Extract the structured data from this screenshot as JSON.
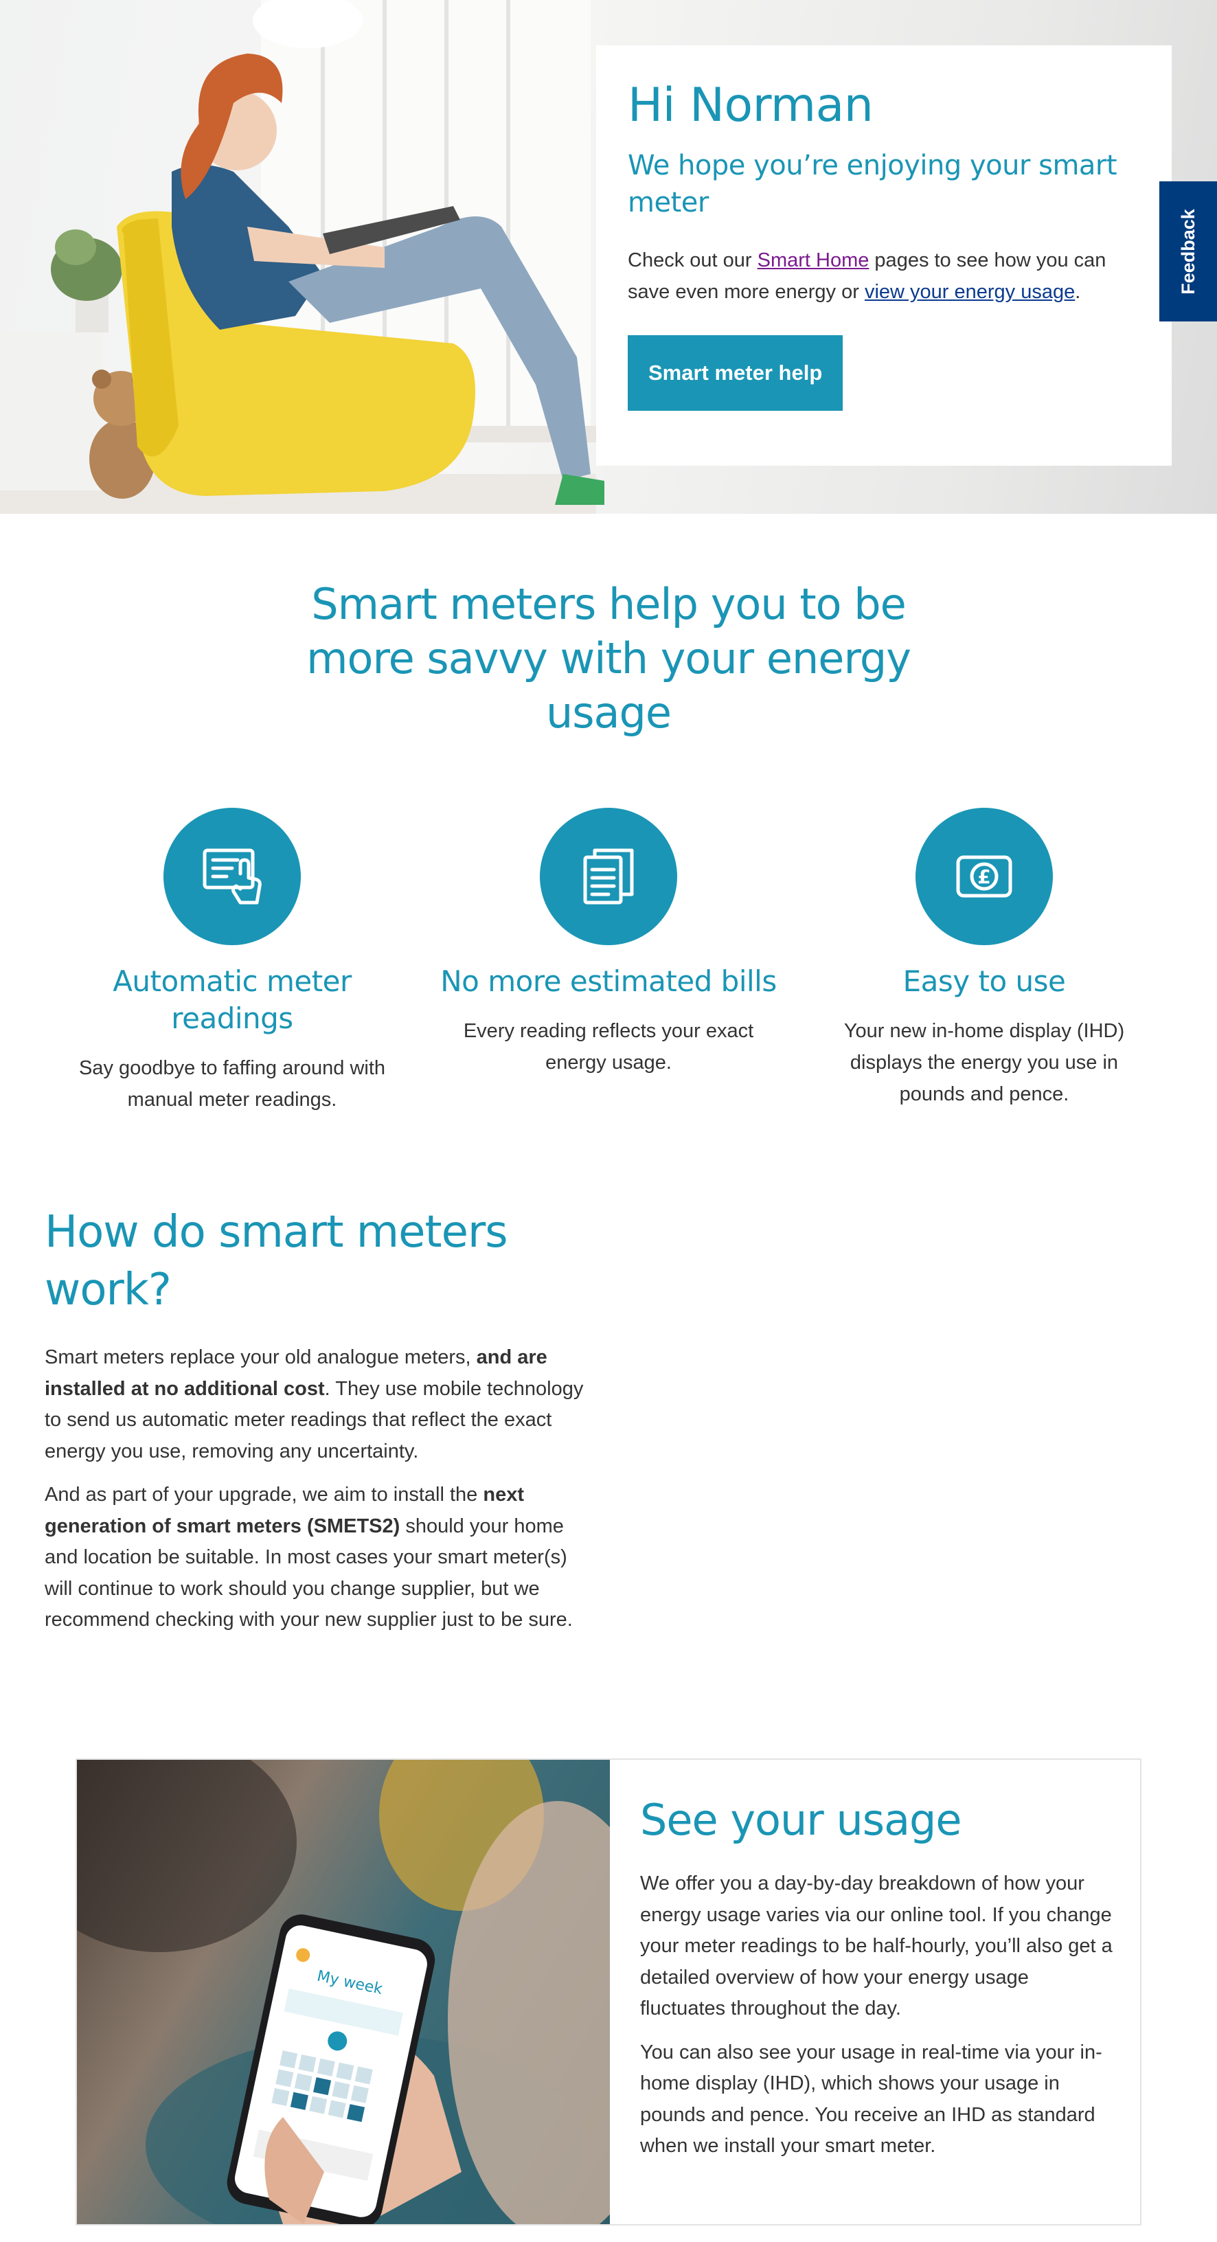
{
  "hero": {
    "greeting": "Hi Norman",
    "subtitle": "We hope you’re enjoying your smart meter",
    "body_prefix": "Check out our ",
    "smart_home_link": "Smart Home",
    "body_middle": " pages to see how you can save even more energy or ",
    "usage_link": "view your energy usage",
    "body_suffix": ".",
    "cta_label": "Smart meter help",
    "image_alt": "Woman relaxing in a yellow chair with a tablet"
  },
  "feedback": {
    "label": "Feedback"
  },
  "benefits": {
    "title": "Smart meters help you to be more savvy with your energy usage",
    "items": [
      {
        "title": "Automatic meter readings",
        "text": "Say goodbye to faffing around with manual meter readings.",
        "icon": "meter-reading-icon"
      },
      {
        "title": "No more estimated bills",
        "text": "Every reading reflects your exact energy usage.",
        "icon": "bills-icon"
      },
      {
        "title": "Easy to use",
        "text": "Your new in-home display (IHD) displays the energy you use in pounds and pence.",
        "icon": "pound-display-icon"
      }
    ]
  },
  "how": {
    "title": "How do smart meters work?",
    "p1_a": "Smart meters replace your old analogue meters, ",
    "p1_bold": "and are installed at no additional cost",
    "p1_b": ". They use mobile technology to send us automatic meter readings that reflect the exact energy you use, removing any uncertainty.",
    "p2_a": "And as part of your upgrade, we aim to install the ",
    "p2_bold": "next generation of smart meters (SMETS2)",
    "p2_b": " should your home and location be suitable. In most cases your smart meter(s) will continue to work should you change supplier, but we recommend checking with your new supplier just to be sure."
  },
  "usage": {
    "title": "See your usage",
    "p1": "We offer you a day-by-day breakdown of how your energy usage varies via our online tool. If you change your meter readings to be half-hourly, you’ll also get a detailed overview of how your energy usage fluctuates throughout the day.",
    "p2": "You can also see your usage in real-time via your in-home display (IHD), which shows your usage in pounds and pence. You receive an IHD as standard when we install your smart meter.",
    "phone_screen_title": "My week"
  },
  "colors": {
    "brand_teal": "#1a95b5",
    "feedback_navy": "#003b7d",
    "visited_link": "#7b1a8f",
    "link": "#0b3a8f"
  }
}
